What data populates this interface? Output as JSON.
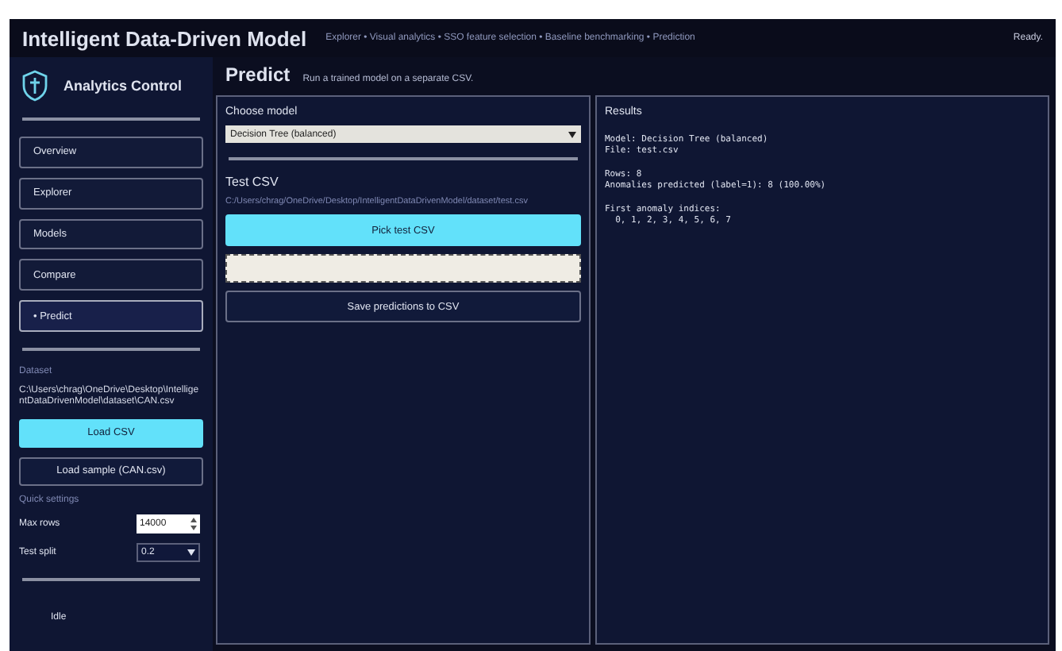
{
  "header": {
    "title": "Intelligent Data-Driven Model",
    "subtitle": "Explorer • Visual analytics • SSO feature selection • Baseline benchmarking • Prediction",
    "status": "Ready."
  },
  "sidebar": {
    "title": "Analytics Control",
    "nav": [
      {
        "label": "Overview",
        "selected": false
      },
      {
        "label": "Explorer",
        "selected": false
      },
      {
        "label": "Models",
        "selected": false
      },
      {
        "label": "Compare",
        "selected": false
      },
      {
        "label": "• Predict",
        "selected": true
      }
    ],
    "dataset_label": "Dataset",
    "dataset_path": "C:\\Users\\chrag\\OneDrive\\Desktop\\IntelligentDataDrivenModel\\dataset\\CAN.csv",
    "load_button": "Load CSV",
    "sample_button": "Load sample (CAN.csv)",
    "settings_label": "Quick settings",
    "settings": [
      {
        "kind": "spin",
        "label": "Max rows",
        "value": "14000"
      },
      {
        "kind": "select",
        "label": "Test split",
        "value": "0.2"
      }
    ],
    "status": "Idle"
  },
  "page": {
    "title": "Predict",
    "subtitle": "Run a trained model on a separate CSV."
  },
  "predict_panel": {
    "model_label": "Choose model",
    "model_value": "Decision Tree (balanced)",
    "test_label": "Test CSV",
    "test_path": "C:/Users/chrag/OneDrive/Desktop/IntelligentDataDrivenModel/dataset/test.csv",
    "pick_button": "Pick test CSV",
    "save_button": "Save predictions to CSV"
  },
  "results": {
    "title": "Results",
    "blocks": [
      [
        "Model: Decision Tree (balanced)",
        "File: test.csv"
      ],
      [
        "Rows: 8",
        "Anomalies predicted (label=1): 8 (100.00%)"
      ],
      [
        "First anomaly indices:",
        "  0, 1, 2, 3, 4, 5, 6, 7"
      ]
    ]
  }
}
